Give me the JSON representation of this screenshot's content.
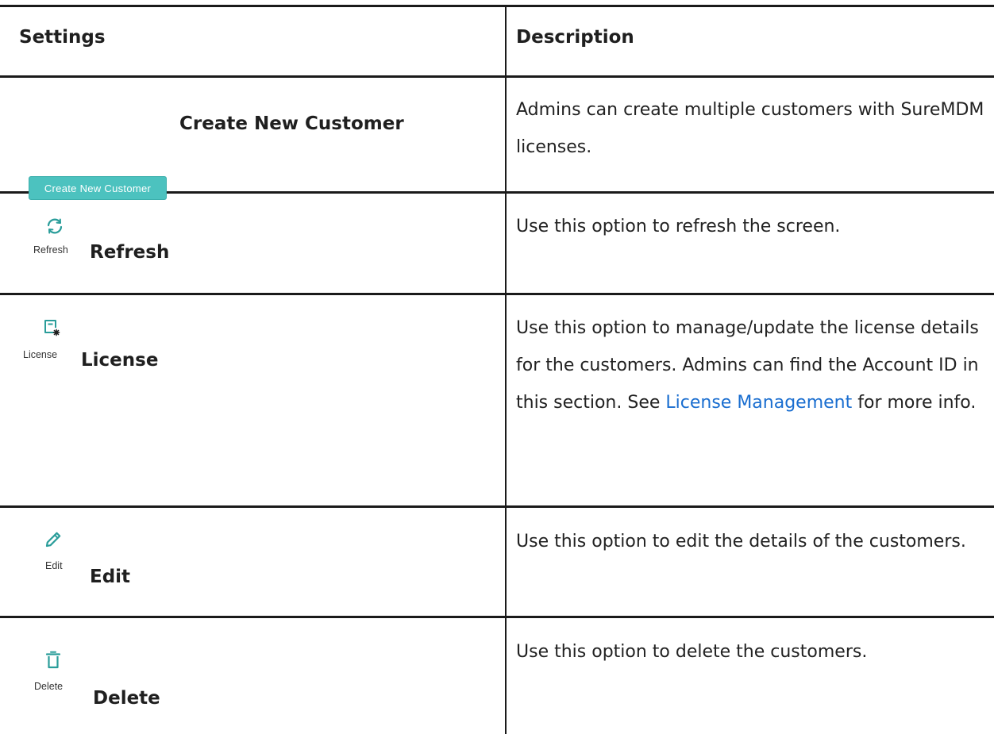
{
  "table": {
    "headers": {
      "settings": "Settings",
      "description": "Description"
    },
    "rows": [
      {
        "button_label": "Create New Customer",
        "title": "Create New Customer",
        "description": "Admins can create multiple customers with SureMDM licenses."
      },
      {
        "icon": "refresh-icon",
        "icon_label": "Refresh",
        "title": "Refresh",
        "description": "Use this option to refresh the screen."
      },
      {
        "icon": "license-icon",
        "icon_label": "License",
        "title": "License",
        "description_before_link": "Use this option to manage/update the license details for the customers. Admins can find the Account ID in this section.  See ",
        "link_text": "License Management",
        "description_after_link": " for more info."
      },
      {
        "icon": "edit-icon",
        "icon_label": "Edit",
        "title": "Edit",
        "description": "Use this option to edit the details of the customers."
      },
      {
        "icon": "delete-icon",
        "icon_label": "Delete",
        "title": "Delete",
        "description": "Use this option to delete the customers."
      }
    ]
  },
  "colors": {
    "button_bg": "#4cc2bf",
    "icon_teal": "#2a9d9a",
    "link": "#1a6ed0",
    "border": "#1a1a1a"
  }
}
